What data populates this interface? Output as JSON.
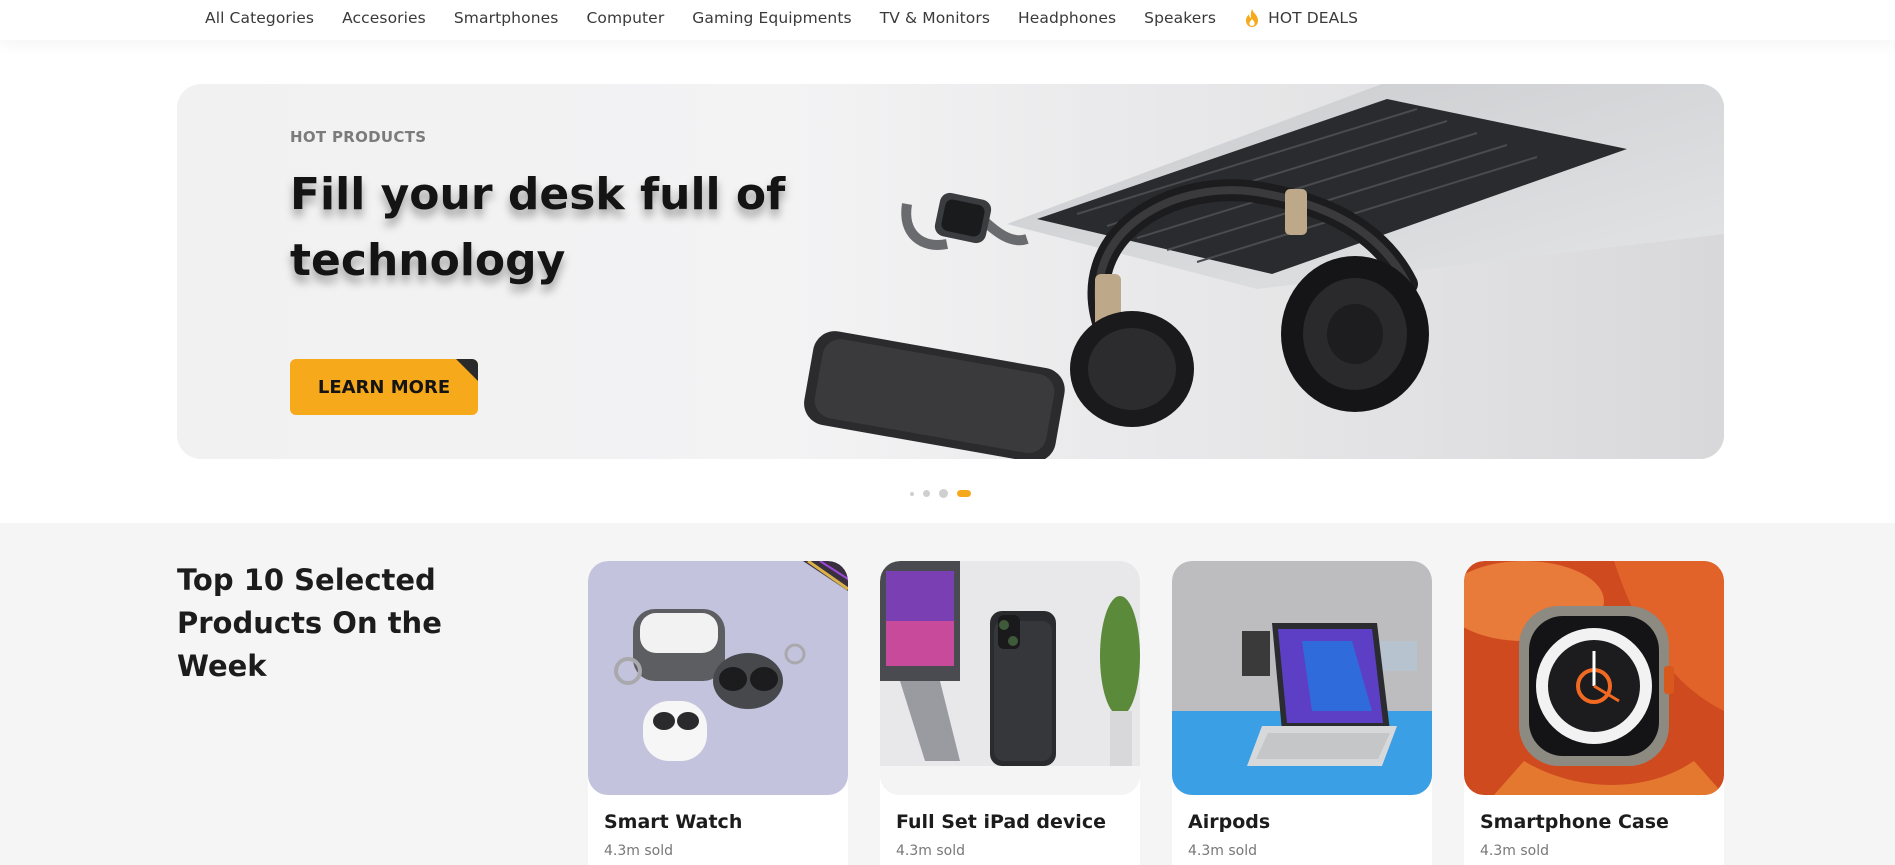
{
  "nav": {
    "items": [
      {
        "label": "All Categories"
      },
      {
        "label": "Accesories"
      },
      {
        "label": "Smartphones"
      },
      {
        "label": "Computer"
      },
      {
        "label": "Gaming Equipments"
      },
      {
        "label": "TV & Monitors"
      },
      {
        "label": "Headphones"
      },
      {
        "label": "Speakers"
      }
    ],
    "hot_deals": {
      "label": "HOT DEALS",
      "icon": "fire-icon"
    }
  },
  "hero": {
    "eyebrow": "HOT PRODUCTS",
    "title": "Fill your desk full of technology",
    "button_label": "LEARN MORE"
  },
  "carousel": {
    "slide_count": 4,
    "active_index": 3
  },
  "products": {
    "title": "Top 10 Selected Products On the Week",
    "cards": [
      {
        "name": "Smart Watch",
        "sold": "4.3m sold"
      },
      {
        "name": "Full Set iPad device",
        "sold": "4.3m sold"
      },
      {
        "name": "Airpods",
        "sold": "4.3m sold"
      },
      {
        "name": "Smartphone Case",
        "sold": "4.3m sold"
      }
    ]
  },
  "colors": {
    "accent": "#f6a91b",
    "section_bg": "#f5f5f5",
    "text": "#1c1c1c"
  }
}
